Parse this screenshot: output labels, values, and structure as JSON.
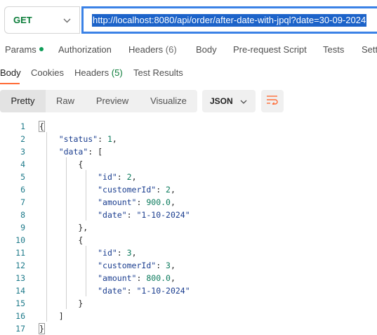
{
  "request": {
    "method": "GET",
    "url": "http://localhost:8080/api/order/after-date-with-jpql?date=30-09-2024"
  },
  "request_tabs": [
    {
      "label": "Params",
      "badge": "dot"
    },
    {
      "label": "Authorization"
    },
    {
      "label": "Headers",
      "count": "(6)"
    },
    {
      "label": "Body"
    },
    {
      "label": "Pre-request Script"
    },
    {
      "label": "Tests"
    },
    {
      "label": "Sett"
    }
  ],
  "response_tabs": [
    {
      "label": "Body",
      "active": true
    },
    {
      "label": "Cookies"
    },
    {
      "label": "Headers",
      "count": "(5)"
    },
    {
      "label": "Test Results"
    }
  ],
  "format": {
    "views": [
      "Pretty",
      "Raw",
      "Preview",
      "Visualize"
    ],
    "active_view": "Pretty",
    "language": "JSON"
  },
  "colors": {
    "method_get": "#0c7d3a",
    "url_selection": "#1c63c9",
    "active_tab_underline": "#ff6c37",
    "line_numbers": "#1e7a8a"
  },
  "code_lines": [
    "{",
    "    \"status\": 1,",
    "    \"data\": [",
    "        {",
    "            \"id\": 2,",
    "            \"customerId\": 2,",
    "            \"amount\": 900.0,",
    "            \"date\": \"1-10-2024\"",
    "        },",
    "        {",
    "            \"id\": 3,",
    "            \"customerId\": 3,",
    "            \"amount\": 800.0,",
    "            \"date\": \"1-10-2024\"",
    "        }",
    "    ]",
    "}"
  ]
}
